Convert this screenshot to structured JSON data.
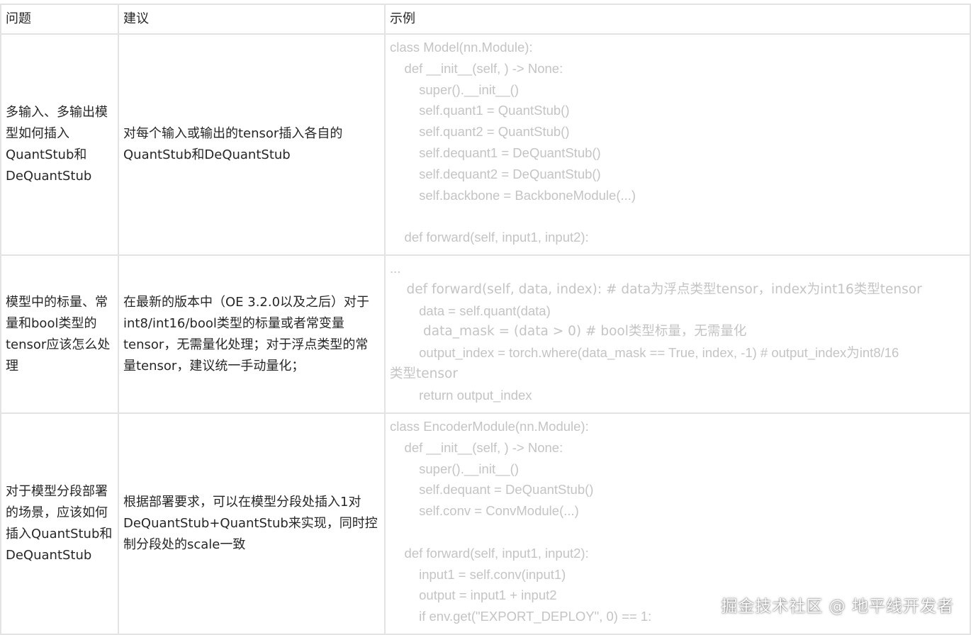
{
  "table": {
    "headers": [
      "问题",
      "建议",
      "示例"
    ],
    "rows": [
      {
        "question": "多输入、多输出模型如何插入QuantStub和DeQuantStub",
        "suggestion": "对每个输入或输出的tensor插入各自的QuantStub和DeQuantStub",
        "code": [
          "class Model(nn.Module):",
          "    def __init__(self, ) -> None:",
          "        super().__init__()",
          "        self.quant1 = QuantStub()",
          "        self.quant2 = QuantStub()",
          "        self.dequant1 = DeQuantStub()",
          "        self.dequant2 = DeQuantStub()",
          "        self.backbone = BackboneModule(...)",
          "",
          "    def forward(self, input1, input2):"
        ]
      },
      {
        "question": "模型中的标量、常量和bool类型的tensor应该怎么处理",
        "suggestion": "在最新的版本中（OE 3.2.0以及之后）对于int8/int16/bool类型的标量或者常变量tensor，无需量化处理；对于浮点类型的常量tensor，建议统一手动量化；",
        "code": [
          "...",
          "    def forward(self, data, index): # data为浮点类型tensor，index为int16类型tensor",
          "        data = self.quant(data)",
          "        data_mask = (data > 0) # bool类型标量，无需量化",
          "        output_index = torch.where(data_mask == True, index, -1) # output_index为int8/16",
          "类型tensor",
          "        return output_index"
        ]
      },
      {
        "question": "对于模型分段部署的场景，应该如何插入QuantStub和DeQuantStub",
        "suggestion": "根据部署要求，可以在模型分段处插入1对DeQuantStub+QuantStub来实现，同时控制分段处的scale一致",
        "code": [
          "class EncoderModule(nn.Module):",
          "    def __init__(self, ) -> None:",
          "        super().__init__()",
          "        self.dequant = DeQuantStub()",
          "        self.conv = ConvModule(...)",
          "",
          "    def forward(self, input1, input2):",
          "        input1 = self.conv(input1)",
          "        output = input1 + input2",
          "        if env.get(\"EXPORT_DEPLOY\", 0) == 1:"
        ]
      }
    ]
  },
  "watermark": "掘金技术社区 @ 地平线开发者"
}
